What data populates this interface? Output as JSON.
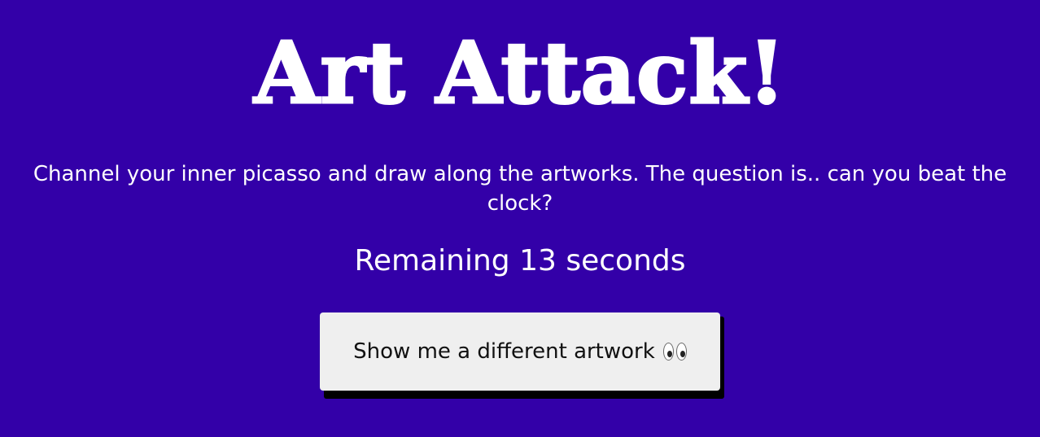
{
  "header": {
    "title": "Art Attack!",
    "subtitle": "Channel your inner picasso and draw along the artworks. The question is.. can you beat the clock?"
  },
  "timer": {
    "prefix": "Remaining",
    "seconds": "13",
    "suffix": "seconds"
  },
  "actions": {
    "different_artwork_label": "Show me a different artwork",
    "different_artwork_icon": "eyes-icon"
  },
  "colors": {
    "background": "#3300a8",
    "text": "#ffffff",
    "button_bg": "#efefef",
    "button_shadow": "#000000"
  }
}
